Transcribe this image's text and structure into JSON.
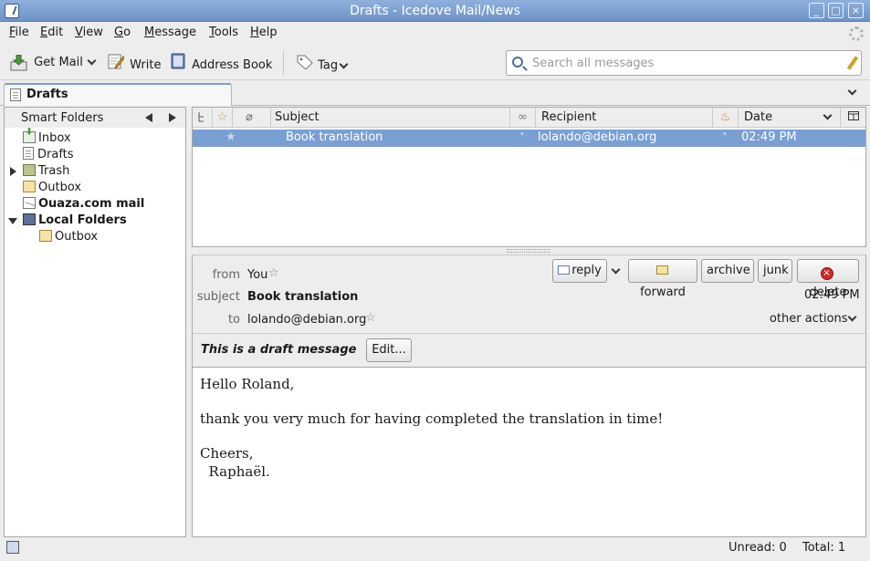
{
  "window": {
    "title": "Drafts - Icedove Mail/News"
  },
  "menubar": {
    "items": [
      "File",
      "Edit",
      "View",
      "Go",
      "Message",
      "Tools",
      "Help"
    ]
  },
  "toolbar": {
    "get_mail": "Get Mail",
    "write": "Write",
    "address_book": "Address Book",
    "tag": "Tag",
    "search_placeholder": "Search all messages"
  },
  "tab": {
    "label": "Drafts"
  },
  "folder_pane": {
    "header": "Smart Folders",
    "folders": [
      {
        "label": "Inbox",
        "icon": "inbox-icon",
        "bold": false
      },
      {
        "label": "Drafts",
        "icon": "drafts-icon",
        "bold": false
      },
      {
        "label": "Trash",
        "icon": "trash-icon",
        "bold": false
      },
      {
        "label": "Outbox",
        "icon": "outbox-icon",
        "bold": false
      },
      {
        "label": "Ouaza.com mail",
        "icon": "mail-account-icon",
        "bold": true
      },
      {
        "label": "Local Folders",
        "icon": "computer-icon",
        "bold": true
      },
      {
        "label": "Outbox",
        "icon": "outbox-icon",
        "bold": false
      }
    ]
  },
  "thread_pane": {
    "columns": {
      "subject": "Subject",
      "recipient": "Recipient",
      "date": "Date"
    },
    "rows": [
      {
        "subject": "Book translation",
        "recipient": "lolando@debian.org",
        "date": "02:49 PM",
        "selected": true
      }
    ]
  },
  "message_header": {
    "from_label": "from",
    "from_value": "You",
    "subject_label": "subject",
    "subject_value": "Book translation",
    "to_label": "to",
    "to_value": "lolando@debian.org",
    "date": "02:49 PM",
    "buttons": {
      "reply": "reply",
      "forward": "forward",
      "archive": "archive",
      "junk": "junk",
      "delete": "delete"
    },
    "other_actions": "other actions"
  },
  "draft_notice": {
    "text": "This is a draft message",
    "edit_button": "Edit..."
  },
  "message_body": {
    "greeting": "Hello Roland,",
    "line1": "thank you very much for having completed the translation in time!",
    "closing": "Cheers,",
    "signature": "  Raphaël."
  },
  "statusbar": {
    "unread": "Unread: 0",
    "total": "Total: 1"
  },
  "colors": {
    "titlebar": "#7a9fd3",
    "selection": "#7a9fd3",
    "background": "#ededed"
  }
}
